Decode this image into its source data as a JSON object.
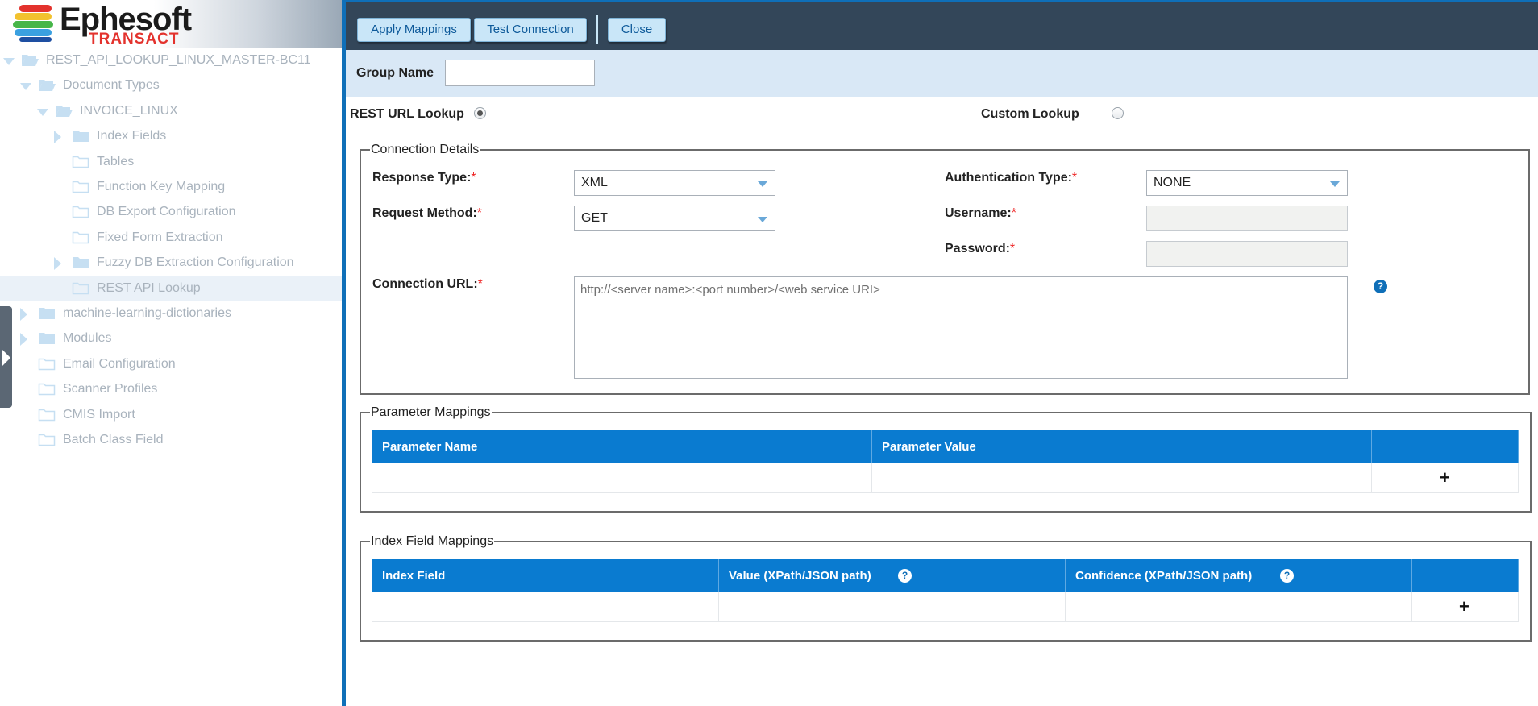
{
  "brand": {
    "name": "Ephesoft",
    "product": "TRANSACT",
    "colors": [
      "#1e4fa2",
      "#3aa0e0",
      "#47b649",
      "#f2c22e",
      "#e3322d"
    ]
  },
  "tree": [
    {
      "label": "REST_API_LOOKUP_LINUX_MASTER-BC11",
      "level": 0,
      "expander": "down",
      "icon": "open-folder-icon"
    },
    {
      "label": "Document Types",
      "level": 1,
      "expander": "down",
      "icon": "open-folder-icon"
    },
    {
      "label": "INVOICE_LINUX",
      "level": 2,
      "expander": "down",
      "icon": "open-folder-icon"
    },
    {
      "label": "Index Fields",
      "level": 3,
      "expander": "right",
      "icon": "folder-icon"
    },
    {
      "label": "Tables",
      "level": 3,
      "expander": "",
      "icon": "empty-folder-icon"
    },
    {
      "label": "Function Key Mapping",
      "level": 3,
      "expander": "",
      "icon": "empty-folder-icon"
    },
    {
      "label": "DB Export Configuration",
      "level": 3,
      "expander": "",
      "icon": "empty-folder-icon"
    },
    {
      "label": "Fixed Form Extraction",
      "level": 3,
      "expander": "",
      "icon": "empty-folder-icon"
    },
    {
      "label": "Fuzzy DB Extraction Configuration",
      "level": 3,
      "expander": "right",
      "icon": "folder-icon"
    },
    {
      "label": "REST API Lookup",
      "level": 3,
      "expander": "",
      "icon": "empty-folder-icon",
      "selected": true
    },
    {
      "label": "machine-learning-dictionaries",
      "level": 1,
      "expander": "right",
      "icon": "folder-icon"
    },
    {
      "label": "Modules",
      "level": 1,
      "expander": "right",
      "icon": "folder-icon"
    },
    {
      "label": "Email Configuration",
      "level": 1,
      "expander": "",
      "icon": "empty-folder-icon"
    },
    {
      "label": "Scanner Profiles",
      "level": 1,
      "expander": "",
      "icon": "empty-folder-icon"
    },
    {
      "label": "CMIS Import",
      "level": 1,
      "expander": "",
      "icon": "empty-folder-icon"
    },
    {
      "label": "Batch Class Field",
      "level": 1,
      "expander": "",
      "icon": "empty-folder-icon"
    }
  ],
  "toolbar": {
    "apply": "Apply Mappings",
    "test": "Test Connection",
    "close": "Close"
  },
  "group": {
    "label": "Group Name",
    "value": ""
  },
  "lookup": {
    "rest_label": "REST URL Lookup",
    "rest_selected": true,
    "custom_label": "Custom Lookup",
    "custom_selected": false
  },
  "connection": {
    "legend": "Connection Details",
    "response_type_label": "Response Type:",
    "response_type_value": "XML",
    "request_method_label": "Request Method:",
    "request_method_value": "GET",
    "auth_type_label": "Authentication Type:",
    "auth_type_value": "NONE",
    "username_label": "Username:",
    "password_label": "Password:",
    "url_label": "Connection URL:",
    "url_placeholder": "http://<server name>:<port number>/<web service URI>",
    "required_mark": "*",
    "help_glyph": "?"
  },
  "param_mappings": {
    "legend": "Parameter Mappings",
    "columns": [
      "Parameter Name",
      "Parameter Value",
      ""
    ],
    "add_glyph": "+"
  },
  "index_mappings": {
    "legend": "Index Field Mappings",
    "columns": [
      "Index Field",
      "Value (XPath/JSON path)",
      "Confidence (XPath/JSON path)",
      ""
    ],
    "help_glyph": "?",
    "add_glyph": "+"
  }
}
